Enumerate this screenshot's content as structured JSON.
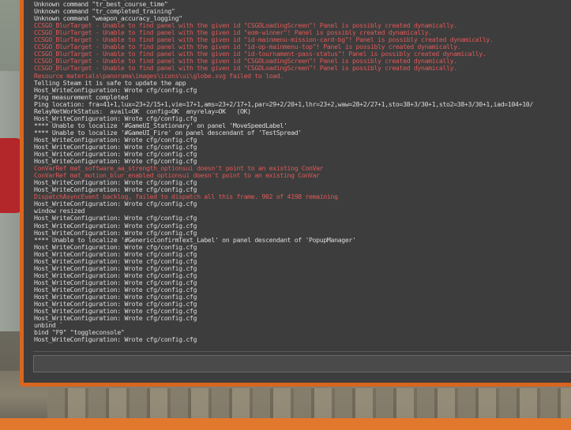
{
  "console": {
    "lines": [
      {
        "text": "Unknown command \"cl_thirdperson\"",
        "type": "normal"
      },
      {
        "text": "Unknown command \"tr_best_course_time\"",
        "type": "normal"
      },
      {
        "text": "Unknown command \"tr_completed_training\"",
        "type": "normal"
      },
      {
        "text": "Unknown command \"weapon_accuracy_logging\"",
        "type": "normal"
      },
      {
        "text": "CCSGO_BlurTarget - Unable to find panel with the given id \"CSGOLoadingScreen\"! Panel is possibly created dynamically.",
        "type": "error"
      },
      {
        "text": "CCSGO_BlurTarget - Unable to find panel with the given id \"eom-winner\"! Panel is possibly created dynamically.",
        "type": "error"
      },
      {
        "text": "CCSGO_BlurTarget - Unable to find panel with the given id \"id-mainmenu-mission-card-bg\"! Panel is possibly created dynamically.",
        "type": "error"
      },
      {
        "text": "CCSGO_BlurTarget - Unable to find panel with the given id \"id-op-mainmenu-top\"! Panel is possibly created dynamically.",
        "type": "error"
      },
      {
        "text": "CCSGO_BlurTarget - Unable to find panel with the given id \"id-tournament-pass-status\"! Panel is possibly created dynamically.",
        "type": "error"
      },
      {
        "text": "CCSGO_BlurTarget - Unable to find panel with the given id \"CSGOLoadingScreen\"! Panel is possibly created dynamically.",
        "type": "error"
      },
      {
        "text": "CCSGO_BlurTarget - Unable to find panel with the given id \"CSGOLoadingScreen\"! Panel is possibly created dynamically.",
        "type": "error"
      },
      {
        "text": "Resource materials\\panorama\\images\\icons\\ui\\globe.svg failed to load.",
        "type": "error"
      },
      {
        "text": "Telling Steam it is safe to update the app",
        "type": "normal"
      },
      {
        "text": "Host_WriteConfiguration: Wrote cfg/config.cfg",
        "type": "normal"
      },
      {
        "text": "Ping measurement completed",
        "type": "normal"
      },
      {
        "text": "Ping location: fra=41+1,lux=23+2/15+1,vie=17+1,ams=23+2/17+1,par=29+2/20+1,lhr=23+2,waw=28+2/27+1,sto=38+3/30+1,sto2=38+3/30+1,iad=104+10/",
        "type": "normal"
      },
      {
        "text": "RelayNetWorkStatus:  avail=OK  config=OK  anyrelay=OK   (OK)",
        "type": "normal"
      },
      {
        "text": "Host_WriteConfiguration: Wrote cfg/config.cfg",
        "type": "normal"
      },
      {
        "text": "**** Unable to localize '#GameUI_Stationary' on panel 'MoveSpeedLabel'",
        "type": "normal"
      },
      {
        "text": "**** Unable to localize '#GameUI_Fire' on panel descendant of 'TestSpread'",
        "type": "normal"
      },
      {
        "text": "Host_WriteConfiguration: Wrote cfg/config.cfg",
        "type": "normal"
      },
      {
        "text": "Host_WriteConfiguration: Wrote cfg/config.cfg",
        "type": "normal"
      },
      {
        "text": "Host_WriteConfiguration: Wrote cfg/config.cfg",
        "type": "normal"
      },
      {
        "text": "Host_WriteConfiguration: Wrote cfg/config.cfg",
        "type": "normal"
      },
      {
        "text": "ConVarRef mat_software_aa_strength_optionsui doesn't point to an existing ConVar",
        "type": "error"
      },
      {
        "text": "ConVarRef mat_motion_blur_enabled_optionsui doesn't point to an existing ConVar",
        "type": "error"
      },
      {
        "text": "Host_WriteConfiguration: Wrote cfg/config.cfg",
        "type": "normal"
      },
      {
        "text": "Host_WriteConfiguration: Wrote cfg/config.cfg",
        "type": "normal"
      },
      {
        "text": "DispatchAsyncEvent backlog, failed to dispatch all this frame. 902 of 4198 remaining",
        "type": "error"
      },
      {
        "text": "Host_WriteConfiguration: Wrote cfg/config.cfg",
        "type": "normal"
      },
      {
        "text": "window resized",
        "type": "normal"
      },
      {
        "text": "Host_WriteConfiguration: Wrote cfg/config.cfg",
        "type": "normal"
      },
      {
        "text": "Host_WriteConfiguration: Wrote cfg/config.cfg",
        "type": "normal"
      },
      {
        "text": "Host_WriteConfiguration: Wrote cfg/config.cfg",
        "type": "normal"
      },
      {
        "text": "**** Unable to localize '#GenericConfirmText_Label' on panel descendant of 'PopupManager'",
        "type": "normal"
      },
      {
        "text": "Host_WriteConfiguration: Wrote cfg/config.cfg",
        "type": "normal"
      },
      {
        "text": "Host_WriteConfiguration: Wrote cfg/config.cfg",
        "type": "normal"
      },
      {
        "text": "Host_WriteConfiguration: Wrote cfg/config.cfg",
        "type": "normal"
      },
      {
        "text": "Host_WriteConfiguration: Wrote cfg/config.cfg",
        "type": "normal"
      },
      {
        "text": "Host_WriteConfiguration: Wrote cfg/config.cfg",
        "type": "normal"
      },
      {
        "text": "Host_WriteConfiguration: Wrote cfg/config.cfg",
        "type": "normal"
      },
      {
        "text": "Host_WriteConfiguration: Wrote cfg/config.cfg",
        "type": "normal"
      },
      {
        "text": "Host_WriteConfiguration: Wrote cfg/config.cfg",
        "type": "normal"
      },
      {
        "text": "Host_WriteConfiguration: Wrote cfg/config.cfg",
        "type": "normal"
      },
      {
        "text": "Host_WriteConfiguration: Wrote cfg/config.cfg",
        "type": "normal"
      },
      {
        "text": "Host_WriteConfiguration: Wrote cfg/config.cfg",
        "type": "normal"
      },
      {
        "text": "unbind `",
        "type": "normal"
      },
      {
        "text": "bind \"F9\" \"toggleconsole\"",
        "type": "normal"
      },
      {
        "text": "Host_WriteConfiguration: Wrote cfg/config.cfg",
        "type": "normal"
      }
    ],
    "input_value": "",
    "colors": {
      "frame": "#d8661f",
      "background": "#3d3d3d",
      "text": "#dcdcdc",
      "error_text": "#e05858",
      "bottom_bar": "#e2782e"
    }
  }
}
